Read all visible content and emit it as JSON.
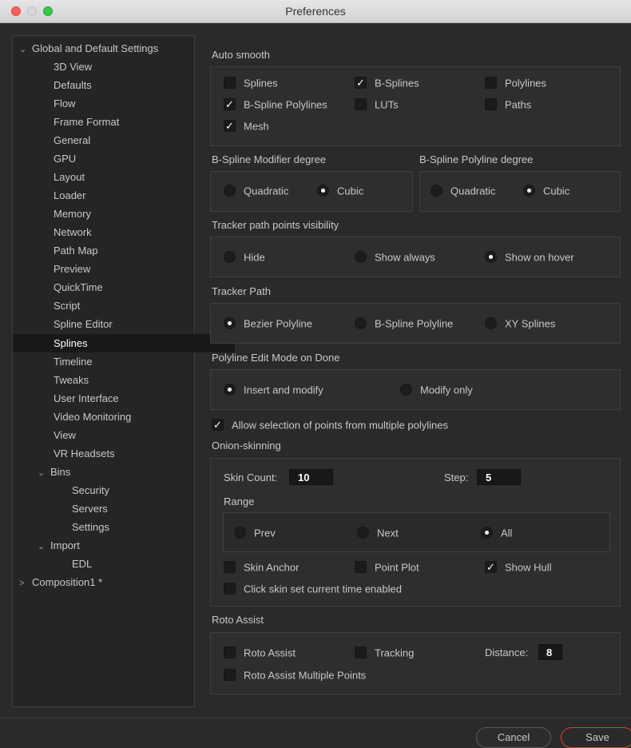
{
  "window": {
    "title": "Preferences"
  },
  "sidebar": {
    "root_label": "Global and Default Settings",
    "items": [
      "3D View",
      "Defaults",
      "Flow",
      "Frame Format",
      "General",
      "GPU",
      "Layout",
      "Loader",
      "Memory",
      "Network",
      "Path Map",
      "Preview",
      "QuickTime",
      "Script",
      "Spline Editor",
      "Splines",
      "Timeline",
      "Tweaks",
      "User Interface",
      "Video Monitoring",
      "View",
      "VR Headsets"
    ],
    "selected": "Splines",
    "bins": {
      "label": "Bins",
      "children": [
        "Security",
        "Servers",
        "Settings"
      ]
    },
    "import": {
      "label": "Import",
      "children": [
        "EDL"
      ]
    },
    "composition": "Composition1 *",
    "expanded_arrow": "⌄",
    "collapsed_arrow": ">"
  },
  "auto_smooth": {
    "label": "Auto smooth",
    "splines": {
      "label": "Splines",
      "checked": false
    },
    "bsplines": {
      "label": "B-Splines",
      "checked": true
    },
    "polylines": {
      "label": "Polylines",
      "checked": false
    },
    "bspline_polylines": {
      "label": "B-Spline Polylines",
      "checked": true
    },
    "luts": {
      "label": "LUTs",
      "checked": false
    },
    "paths": {
      "label": "Paths",
      "checked": false
    },
    "mesh": {
      "label": "Mesh",
      "checked": true
    }
  },
  "bspline_modifier_degree": {
    "label": "B-Spline Modifier degree",
    "options": [
      "Quadratic",
      "Cubic"
    ],
    "selected": "Cubic"
  },
  "bspline_polyline_degree": {
    "label": "B-Spline Polyline degree",
    "options": [
      "Quadratic",
      "Cubic"
    ],
    "selected": "Cubic"
  },
  "tracker_visibility": {
    "label": "Tracker path points visibility",
    "options": [
      "Hide",
      "Show always",
      "Show on hover"
    ],
    "selected": "Show on hover"
  },
  "tracker_path": {
    "label": "Tracker Path",
    "options": [
      "Bezier Polyline",
      "B-Spline Polyline",
      "XY Splines"
    ],
    "selected": "Bezier Polyline"
  },
  "polyline_edit_mode": {
    "label": "Polyline Edit Mode on Done",
    "options": [
      "Insert and modify",
      "Modify only"
    ],
    "selected": "Insert and modify"
  },
  "allow_selection": {
    "label": "Allow selection of points from multiple polylines",
    "checked": true
  },
  "onion_skinning": {
    "label": "Onion-skinning",
    "skin_count_label": "Skin Count:",
    "skin_count": "10",
    "step_label": "Step:",
    "step": "5",
    "range_label": "Range",
    "range_options": [
      "Prev",
      "Next",
      "All"
    ],
    "range_selected": "All",
    "skin_anchor": {
      "label": "Skin Anchor",
      "checked": false
    },
    "point_plot": {
      "label": "Point Plot",
      "checked": false
    },
    "show_hull": {
      "label": "Show Hull",
      "checked": true
    },
    "click_skin": {
      "label": "Click skin set current time enabled",
      "checked": false
    }
  },
  "roto_assist": {
    "label": "Roto Assist",
    "roto_assist": {
      "label": "Roto Assist",
      "checked": false
    },
    "tracking": {
      "label": "Tracking",
      "checked": false
    },
    "distance_label": "Distance:",
    "distance": "8",
    "multiple_points": {
      "label": "Roto Assist Multiple Points",
      "checked": false
    }
  },
  "buttons": {
    "cancel": "Cancel",
    "save": "Save"
  },
  "check_mark": "✓",
  "colors": {
    "background": "#2a2a2a",
    "panel": "#2e2e2e",
    "selected_row": "#181818",
    "save_border": "#e0402c"
  }
}
